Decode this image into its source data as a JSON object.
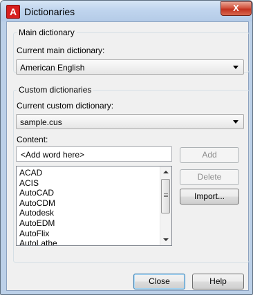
{
  "window": {
    "title": "Dictionaries",
    "close_glyph": "X"
  },
  "main_dictionary": {
    "group_label": "Main dictionary",
    "current_label": "Current main dictionary:",
    "selected": "American English"
  },
  "custom_dictionaries": {
    "group_label": "Custom dictionaries",
    "current_label": "Current custom dictionary:",
    "selected": "sample.cus",
    "content_label": "Content:",
    "input_value": "<Add word here>",
    "words": [
      "ACAD",
      "ACIS",
      "AutoCAD",
      "AutoCDM",
      "Autodesk",
      "AutoEDM",
      "AutoFlix",
      "AutoLathe"
    ]
  },
  "buttons": {
    "add": "Add",
    "delete": "Delete",
    "import": "Import...",
    "close": "Close",
    "help": "Help"
  },
  "colors": {
    "app_icon": "#d71f1f",
    "title_close": "#c2321f"
  }
}
